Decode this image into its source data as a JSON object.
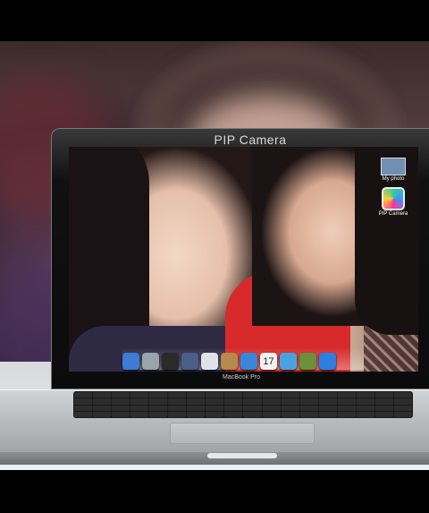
{
  "window": {
    "title": "PIP Camera"
  },
  "laptop": {
    "brand": "MacBook Pro"
  },
  "desktop_icons": [
    {
      "icon": "folder-thumbnail-icon",
      "label": "My photo"
    },
    {
      "icon": "pip-camera-app-icon",
      "label": "PIP Camera"
    }
  ],
  "dock": {
    "items": [
      {
        "icon": "finder-icon",
        "color": "#3d7bd6"
      },
      {
        "icon": "launchpad-icon",
        "color": "#9aa4ad"
      },
      {
        "icon": "dashboard-icon",
        "color": "#2a2a2a"
      },
      {
        "icon": "mission-control-icon",
        "color": "#4a5f8c"
      },
      {
        "icon": "mail-icon",
        "color": "#dfe3e8"
      },
      {
        "icon": "contacts-icon",
        "color": "#b58a4b"
      },
      {
        "icon": "itunes-icon",
        "color": "#3b86d8"
      },
      {
        "icon": "calendar-icon",
        "color": "#f2f2f2",
        "text": "17"
      },
      {
        "icon": "safari-icon",
        "color": "#4aa3e0"
      },
      {
        "icon": "iphoto-icon",
        "color": "#6b8f3a"
      },
      {
        "icon": "app-store-icon",
        "color": "#2b7fe0"
      }
    ]
  }
}
